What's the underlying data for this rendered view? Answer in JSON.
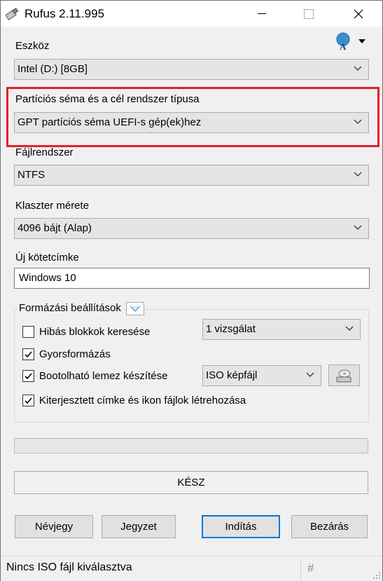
{
  "window": {
    "title": "Rufus 2.11.995"
  },
  "device": {
    "label": "Eszköz",
    "value": "Intel (D:) [8GB]"
  },
  "partition": {
    "label": "Partíciós séma és a cél rendszer típusa",
    "value": "GPT partíciós séma UEFI-s gép(ek)hez",
    "highlight_color": "#e3202a"
  },
  "filesystem": {
    "label": "Fájlrendszer",
    "value": "NTFS"
  },
  "cluster": {
    "label": "Klaszter mérete",
    "value": "4096 bájt (Alap)"
  },
  "volume": {
    "label": "Új kötetcímke",
    "value": "Windows 10"
  },
  "format_options": {
    "title": "Formázási beállítások",
    "bad_blocks": {
      "label": "Hibás blokkok keresése",
      "checked": false,
      "passes": "1 vizsgálat"
    },
    "quick_format": {
      "label": "Gyorsformázás",
      "checked": true
    },
    "bootable": {
      "label": "Bootolható lemez készítése",
      "checked": true,
      "type": "ISO képfájl"
    },
    "extended_label": {
      "label": "Kiterjesztett címke és ikon fájlok létrehozása",
      "checked": true
    }
  },
  "progress": {
    "value": 0
  },
  "status": "KÉSZ",
  "buttons": {
    "about": "Névjegy",
    "log": "Jegyzet",
    "start": "Indítás",
    "close": "Bezárás"
  },
  "statusbar": {
    "text": "Nincs ISO fájl kiválasztva",
    "hash": "#"
  },
  "icons": {
    "app": "usb-drive-icon",
    "language": "globe-language-icon",
    "iso_select": "disc-drive-icon"
  },
  "colors": {
    "default_button_border": "#0078d7"
  }
}
